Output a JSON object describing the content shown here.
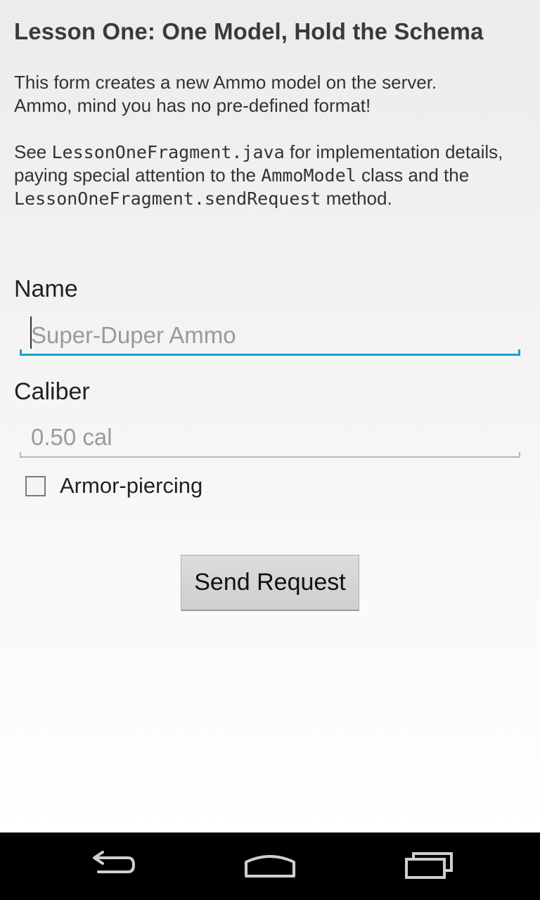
{
  "header": {
    "title": "Lesson One: One Model, Hold the Schema"
  },
  "description": {
    "p1_line1": "This form creates a new Ammo model on the server.",
    "p1_line2": "Ammo, mind you has no pre-defined format!",
    "p2_see": "See ",
    "p2_code1": "LessonOneFragment.java",
    "p2_mid": " for implementation details, paying special attention to the ",
    "p2_code2": "AmmoModel",
    "p2_mid2": " class and the ",
    "p2_code3": "LessonOneFragment.sendRequest",
    "p2_end": " method."
  },
  "form": {
    "name_label": "Name",
    "name_value": "",
    "name_placeholder": "Super-Duper Ammo",
    "caliber_label": "Caliber",
    "caliber_value": "",
    "caliber_placeholder": "0.50 cal",
    "armor_piercing_label": "Armor-piercing",
    "armor_piercing_checked": false,
    "send_button_label": "Send Request"
  },
  "navbar": {
    "back_icon": "back-icon",
    "home_icon": "home-icon",
    "recents_icon": "recents-icon"
  },
  "colors": {
    "focused_underline": "#1aa0d3",
    "navbar_bg": "#000000"
  }
}
